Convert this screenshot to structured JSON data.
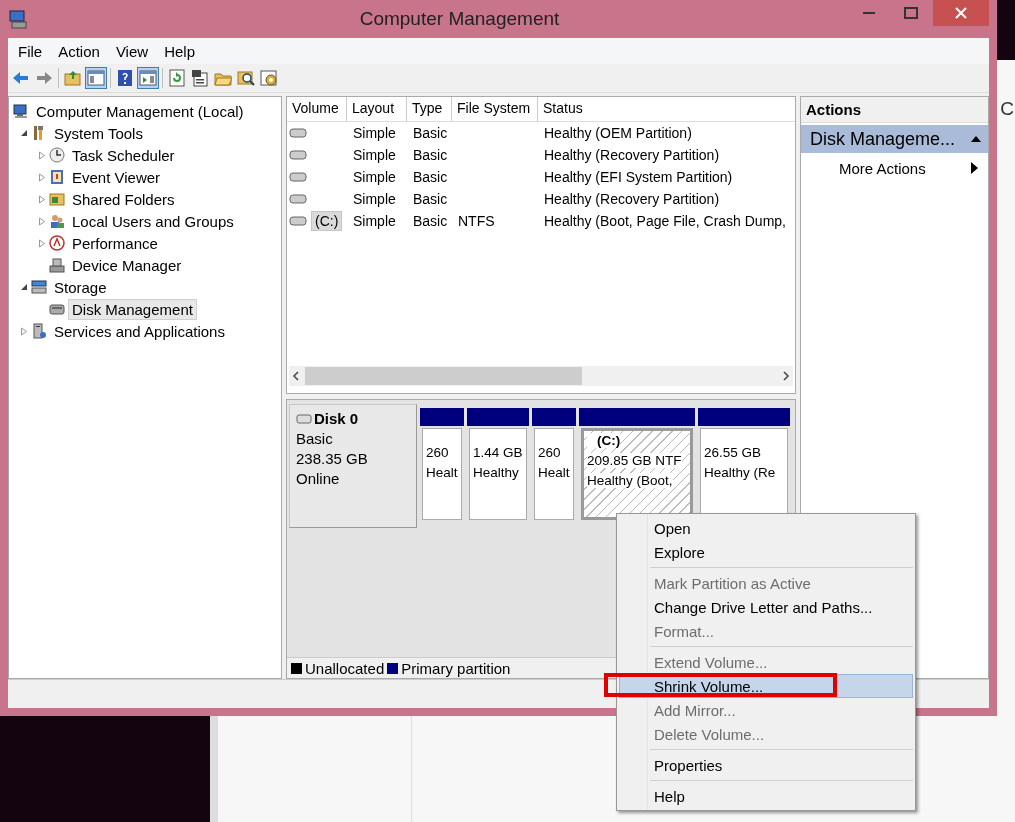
{
  "window": {
    "title": "Computer Management"
  },
  "menu_bar": [
    "File",
    "Action",
    "View",
    "Help"
  ],
  "toolbar": [
    {
      "kind": "back",
      "pressed": false
    },
    {
      "kind": "forward",
      "pressed": false
    },
    {
      "kind": "separator"
    },
    {
      "kind": "up",
      "pressed": false
    },
    {
      "kind": "console-tree",
      "pressed": true
    },
    {
      "kind": "separator"
    },
    {
      "kind": "help",
      "pressed": false
    },
    {
      "kind": "action-pane",
      "pressed": true
    },
    {
      "kind": "separator"
    },
    {
      "kind": "refresh",
      "pressed": false
    },
    {
      "kind": "properties",
      "pressed": false
    },
    {
      "kind": "open",
      "pressed": false
    },
    {
      "kind": "find",
      "pressed": false
    },
    {
      "kind": "settings",
      "pressed": false
    }
  ],
  "tree": [
    {
      "label": "Computer Management (Local)",
      "kind": "computer",
      "selected": false,
      "children": [
        {
          "label": "System Tools",
          "kind": "tools",
          "expanded": true,
          "selected": false,
          "children": [
            {
              "label": "Task Scheduler",
              "kind": "clock",
              "expanded": false,
              "selected": false
            },
            {
              "label": "Event Viewer",
              "kind": "log",
              "expanded": false,
              "selected": false
            },
            {
              "label": "Shared Folders",
              "kind": "share",
              "expanded": false,
              "selected": false
            },
            {
              "label": "Local Users and Groups",
              "kind": "users",
              "expanded": false,
              "selected": false
            },
            {
              "label": "Performance",
              "kind": "gauge",
              "expanded": false,
              "selected": false
            },
            {
              "label": "Device Manager",
              "kind": "device",
              "selected": false
            }
          ]
        },
        {
          "label": "Storage",
          "kind": "storage",
          "expanded": true,
          "selected": false,
          "children": [
            {
              "label": "Disk Management",
              "kind": "disk",
              "selected": true
            }
          ]
        },
        {
          "label": "Services and Applications",
          "kind": "services",
          "expanded": false,
          "selected": false
        }
      ]
    }
  ],
  "table": {
    "columns": [
      "Volume",
      "Layout",
      "Type",
      "File System",
      "Status"
    ],
    "rows": [
      {
        "volume": "",
        "layout": "Simple",
        "type": "Basic",
        "file_system": "",
        "status": "Healthy (OEM Partition)",
        "selected": false
      },
      {
        "volume": "",
        "layout": "Simple",
        "type": "Basic",
        "file_system": "",
        "status": "Healthy (Recovery Partition)",
        "selected": false
      },
      {
        "volume": "",
        "layout": "Simple",
        "type": "Basic",
        "file_system": "",
        "status": "Healthy (EFI System Partition)",
        "selected": false
      },
      {
        "volume": "",
        "layout": "Simple",
        "type": "Basic",
        "file_system": "",
        "status": "Healthy (Recovery Partition)",
        "selected": false
      },
      {
        "volume": "(C:)",
        "layout": "Simple",
        "type": "Basic",
        "file_system": "NTFS",
        "status": "Healthy (Boot, Page File, Crash Dump,",
        "selected": true
      }
    ]
  },
  "disks": [
    {
      "name": "Disk 0",
      "type": "Basic",
      "size": "238.35 GB",
      "status": "Online",
      "partitions": [
        {
          "size": "260",
          "status": "Healt",
          "selected": false
        },
        {
          "size": "1.44 GB",
          "status": "Healthy",
          "selected": false
        },
        {
          "size": "260",
          "status": "Healt",
          "selected": false
        },
        {
          "label": "(C:)",
          "size": "209.85 GB NTF",
          "status": "Healthy (Boot,",
          "selected": true
        },
        {
          "size": "26.55 GB",
          "status": "Healthy (Re",
          "selected": false
        }
      ]
    }
  ],
  "legend": [
    {
      "label": "Unallocated",
      "color": "#000000"
    },
    {
      "label": "Primary partition",
      "color": "#000080"
    }
  ],
  "actions": {
    "heading": "Actions",
    "section": {
      "label": "Disk Manageme...",
      "expanded": true
    },
    "items": [
      "More Actions"
    ]
  },
  "context_menu": [
    {
      "kind": "item",
      "label": "Open",
      "disabled": false,
      "selected": false
    },
    {
      "kind": "item",
      "label": "Explore",
      "disabled": false,
      "selected": false
    },
    {
      "kind": "separator"
    },
    {
      "kind": "item",
      "label": "Mark Partition as Active",
      "disabled": true,
      "selected": false
    },
    {
      "kind": "item",
      "label": "Change Drive Letter and Paths...",
      "disabled": false,
      "selected": false
    },
    {
      "kind": "item",
      "label": "Format...",
      "disabled": true,
      "selected": false
    },
    {
      "kind": "separator"
    },
    {
      "kind": "item",
      "label": "Extend Volume...",
      "disabled": true,
      "selected": false
    },
    {
      "kind": "item",
      "label": "Shrink Volume...",
      "disabled": false,
      "selected": true
    },
    {
      "kind": "item",
      "label": "Add Mirror...",
      "disabled": true,
      "selected": false
    },
    {
      "kind": "item",
      "label": "Delete Volume...",
      "disabled": true,
      "selected": false
    },
    {
      "kind": "separator"
    },
    {
      "kind": "item",
      "label": "Properties",
      "disabled": false,
      "selected": false
    },
    {
      "kind": "separator"
    },
    {
      "kind": "item",
      "label": "Help",
      "disabled": false,
      "selected": false
    }
  ],
  "background_window": {
    "text": "C"
  }
}
